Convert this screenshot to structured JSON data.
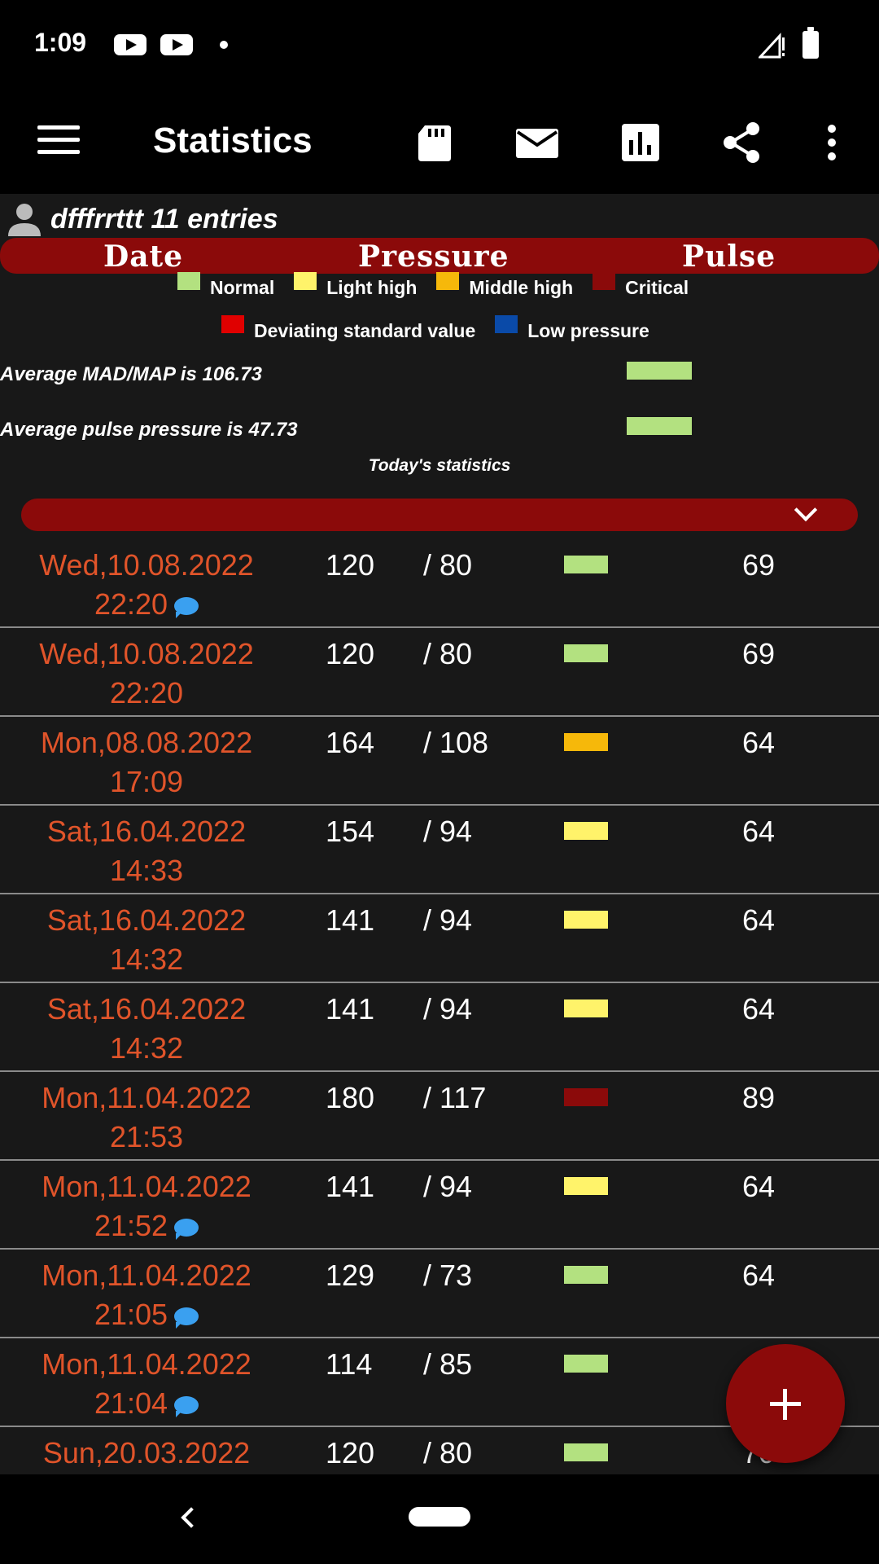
{
  "status_bar": {
    "time": "1:09",
    "icons": [
      "youtube-icon",
      "youtube-icon",
      "notification-dot",
      "signal-icon",
      "battery-icon"
    ]
  },
  "toolbar": {
    "title": "Statistics",
    "icons": [
      "menu-icon",
      "sd-card-icon",
      "mail-icon",
      "bar-chart-icon",
      "share-icon",
      "more-vert-icon"
    ]
  },
  "user": {
    "label": "dfffrrttt 11 entries"
  },
  "header": {
    "date": "Date",
    "pressure": "Pressure",
    "pulse": "Pulse",
    "color": "#8b0a0a"
  },
  "legend": {
    "normal": "Normal",
    "light_high": "Light high",
    "middle_high": "Middle high",
    "critical": "Critical",
    "deviating": "Deviating standard value",
    "low_pressure": "Low pressure",
    "colors": {
      "normal": "#b3e180",
      "light_high": "#fff36a",
      "middle_high": "#f6b80a",
      "critical": "#8b0a0a",
      "deviating": "#e00000",
      "low_pressure": "#0a4aa8"
    }
  },
  "averages": {
    "map": "Average MAD/MAP is 106.73",
    "pulse_pressure": "Average pulse pressure is 47.73",
    "today": "Today's statistics"
  },
  "entries": [
    {
      "date": "Wed,10.08.2022",
      "time": "22:20",
      "sys": "120",
      "dia": "/ 80",
      "pulse": "69",
      "level": "normal",
      "comment": true
    },
    {
      "date": "Wed,10.08.2022",
      "time": "22:20",
      "sys": "120",
      "dia": "/ 80",
      "pulse": "69",
      "level": "normal",
      "comment": false
    },
    {
      "date": "Mon,08.08.2022",
      "time": "17:09",
      "sys": "164",
      "dia": "/ 108",
      "pulse": "64",
      "level": "middle_high",
      "comment": false
    },
    {
      "date": "Sat,16.04.2022",
      "time": "14:33",
      "sys": "154",
      "dia": "/ 94",
      "pulse": "64",
      "level": "light_high",
      "comment": false
    },
    {
      "date": "Sat,16.04.2022",
      "time": "14:32",
      "sys": "141",
      "dia": "/ 94",
      "pulse": "64",
      "level": "light_high",
      "comment": false
    },
    {
      "date": "Sat,16.04.2022",
      "time": "14:32",
      "sys": "141",
      "dia": "/ 94",
      "pulse": "64",
      "level": "light_high",
      "comment": false
    },
    {
      "date": "Mon,11.04.2022",
      "time": "21:53",
      "sys": "180",
      "dia": "/ 117",
      "pulse": "89",
      "level": "critical",
      "comment": false
    },
    {
      "date": "Mon,11.04.2022",
      "time": "21:52",
      "sys": "141",
      "dia": "/ 94",
      "pulse": "64",
      "level": "light_high",
      "comment": true
    },
    {
      "date": "Mon,11.04.2022",
      "time": "21:05",
      "sys": "129",
      "dia": "/ 73",
      "pulse": "64",
      "level": "normal",
      "comment": true
    },
    {
      "date": "Mon,11.04.2022",
      "time": "21:04",
      "sys": "114",
      "dia": "/ 85",
      "pulse": "",
      "level": "normal",
      "comment": true
    },
    {
      "date": "Sun,20.03.2022",
      "time": "",
      "sys": "120",
      "dia": "/ 80",
      "pulse": "70",
      "level": "normal",
      "comment": false
    }
  ],
  "fab": {
    "icon": "add-icon"
  }
}
